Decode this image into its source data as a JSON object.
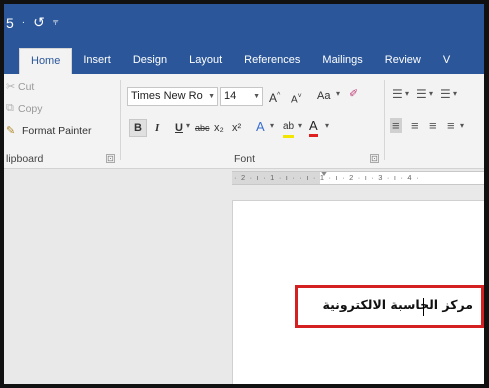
{
  "quick_access": {
    "undo_icon": "undo-icon",
    "redo_icon": "redo-icon",
    "customize_icon": "customize-qat-icon",
    "undo_glyph": "5",
    "undo_dd": "·",
    "redo_glyph": "↺",
    "customize_glyph": "⫧"
  },
  "tabs": [
    "Home",
    "Insert",
    "Design",
    "Layout",
    "References",
    "Mailings",
    "Review",
    "V"
  ],
  "active_tab": "Home",
  "clipboard": {
    "cut": "Cut",
    "copy": "Copy",
    "format_painter": "Format Painter",
    "group_label": "lipboard",
    "launcher": "⊡"
  },
  "font": {
    "family": "Times New Ro",
    "size": "14",
    "grow": "A",
    "grow_sup": "^",
    "shrink": "A",
    "shrink_sup": "˅",
    "change_case": "Aa",
    "bold": "B",
    "italic": "I",
    "underline": "U",
    "strike": "abc",
    "subscript": "x₂",
    "superscript": "x²",
    "text_effects": "A",
    "highlight": "ab",
    "font_color": "A",
    "group_label": "Font",
    "launcher": "⊡"
  },
  "ruler": {
    "marks": "· 2 · ı · 1 · ı ·   · ı · 1 · ı · 2 · ı · 3 · ı · 4 ·"
  },
  "document": {
    "text": "مركز الحاسبة الالكترونية"
  },
  "colors": {
    "title_bar": "#2b579a",
    "highlight_border": "#d42020"
  }
}
